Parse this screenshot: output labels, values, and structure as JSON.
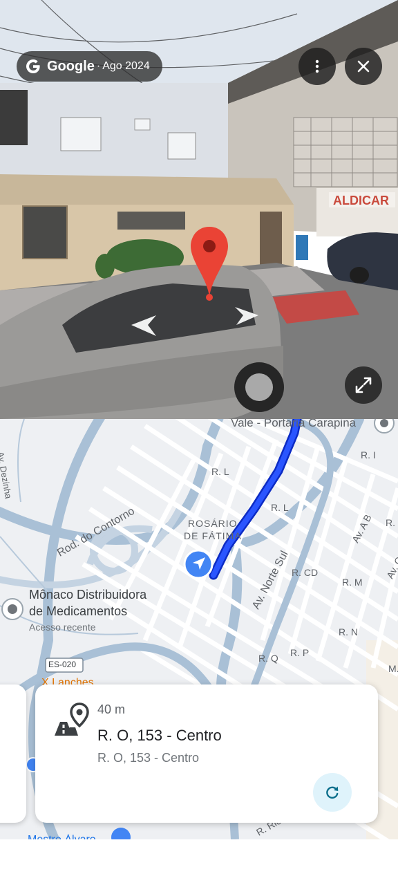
{
  "street_view": {
    "brand": "Google",
    "separator": "·",
    "date": "Ago 2024",
    "shop_sign": "ALDICAR",
    "icons": [
      "google-g-icon",
      "more-vert-icon",
      "close-icon",
      "expand-icon",
      "location-pin-icon",
      "nav-arrow-left-icon",
      "nav-arrow-right-icon"
    ]
  },
  "map": {
    "labels": {
      "vale": "Vale - Portaria Carapina",
      "rosario_1": "ROSÁRIO",
      "rosario_2": "DE FÁTIMA",
      "monaco_1": "Mônaco Distribuidora",
      "monaco_2": "de Medicamentos",
      "monaco_sub": "Acesso recente",
      "road_contorno": "Rod. do Contorno",
      "av_norte_sul": "Av. Norte Sul",
      "es020": "ES-020",
      "lanches": "X Lanches",
      "rua_i": "R. I",
      "rua_l1": "R. L",
      "rua_l2": "R. L",
      "rua_cd": "R. CD",
      "rua_m": "R. M",
      "rua_n": "R. N",
      "rua_p": "R. P",
      "rua_q": "R. Q",
      "av_ab": "Av. A B",
      "av_c": "Av. C",
      "rua_partial": "R.",
      "left_street": "Av. Dezinha",
      "right_m": "M.",
      "bottom_rio": "R. Rio C.",
      "bottom_left": "Mestre Álvaro"
    },
    "colors": {
      "route": "#1a3ff0",
      "road": "#a9c0d6",
      "land": "#eef0f3",
      "user": "#4285f4"
    }
  },
  "card": {
    "distance": "40 m",
    "title": "R. O, 153 - Centro",
    "subtitle": "R. O, 153 - Centro",
    "icon": "street-place-icon",
    "refresh_icon": "refresh-icon"
  }
}
